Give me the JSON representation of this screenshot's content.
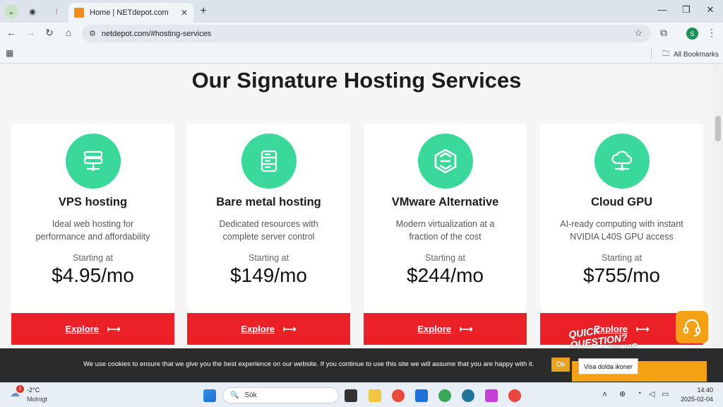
{
  "browser": {
    "tab_title": "Home | NETdepot.com",
    "url": "netdepot.com/#hosting-services",
    "profile_initial": "S",
    "bookmarks_label": "All Bookmarks"
  },
  "page": {
    "heading": "Our Signature Hosting Services",
    "cards": [
      {
        "name": "VPS hosting",
        "desc1": "Ideal web hosting for",
        "desc2": "performance and affordability",
        "starting": "Starting at",
        "price": "$4.95/mo",
        "cta": "Explore",
        "icon": "server-stack-icon"
      },
      {
        "name": "Bare metal hosting",
        "desc1": "Dedicated resources with",
        "desc2": "complete server control",
        "starting": "Starting at",
        "price": "$149/mo",
        "cta": "Explore",
        "icon": "database-server-icon"
      },
      {
        "name": "VMware Alternative",
        "desc1": "Modern virtualization at a",
        "desc2": "fraction of the cost",
        "starting": "Starting at",
        "price": "$244/mo",
        "cta": "Explore",
        "icon": "hexagon-logo-icon"
      },
      {
        "name": "Cloud GPU",
        "desc1": "AI-ready computing with instant",
        "desc2": "NVIDIA L40S GPU access",
        "starting": "Starting at",
        "price": "$755/mo",
        "cta": "Explore",
        "icon": "cloud-network-icon"
      }
    ]
  },
  "cookie": {
    "text": "We use cookies to ensure that we give you the best experience on our website. If you continue to use this site we will assume that you are happy with it.",
    "ok": "Ok"
  },
  "chat": {
    "promo": "QUICK QUESTION? SPEAK TO US HERE!"
  },
  "tooltip": "Visa dolda ikoner",
  "taskbar": {
    "weather_temp": "-2°C",
    "weather_desc": "Molnigt",
    "weather_badge": "2",
    "search_placeholder": "Sök",
    "time": "14:40",
    "date": "2025-02-04"
  },
  "colors": {
    "accent_green": "#3ad89b",
    "cta_red": "#ec2027",
    "chat_orange": "#f4a113"
  }
}
